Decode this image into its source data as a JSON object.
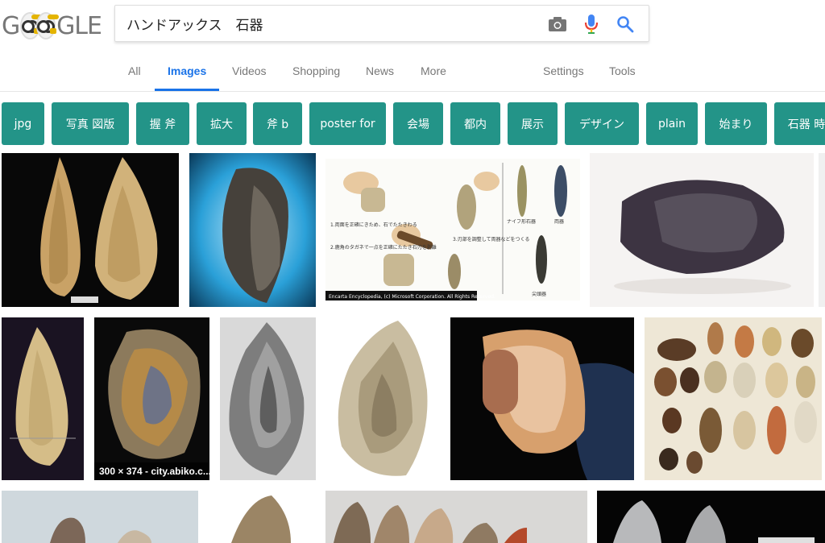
{
  "logo": {
    "left_letters": "G",
    "right_letters": "GLE"
  },
  "search": {
    "query": "ハンドアックス　石器"
  },
  "icons": {
    "camera": "camera-icon",
    "mic": "mic-icon",
    "search": "search-icon"
  },
  "colors": {
    "accent": "#1a73e8",
    "chip_bg": "#239488",
    "mic_red": "#ea4335"
  },
  "tabs": {
    "all": "All",
    "images": "Images",
    "videos": "Videos",
    "shopping": "Shopping",
    "news": "News",
    "more": "More",
    "settings": "Settings",
    "tools": "Tools"
  },
  "chips": [
    "jpg",
    "写真 図版",
    "握 斧",
    "拡大",
    "斧 b",
    "poster for",
    "会場",
    "都内",
    "展示",
    "デザイン",
    "plain",
    "始まり",
    "石器 時"
  ],
  "results": {
    "caption_6": "300 × 374 - city.abiko.c...",
    "row1": [
      "Two flint hand axes on black background",
      "Dark stone hand axe on blue background",
      "Encyclopedia diagram of stone tool making",
      "Dark hand axe on white background"
    ],
    "encarta_credit": "Encarta Encyclopedia, (c) Microsoft Corporation. All Rights Reserved.",
    "encarta_labels": [
      "1.両面を正確にきため、石でたたきわる",
      "2.鹿角のタガネで一点を正確にたたき石刃を剥離",
      "3.刃部を調整して両器などをつくる",
      "ナイフ形石器",
      "両器",
      "尖頭器"
    ]
  }
}
